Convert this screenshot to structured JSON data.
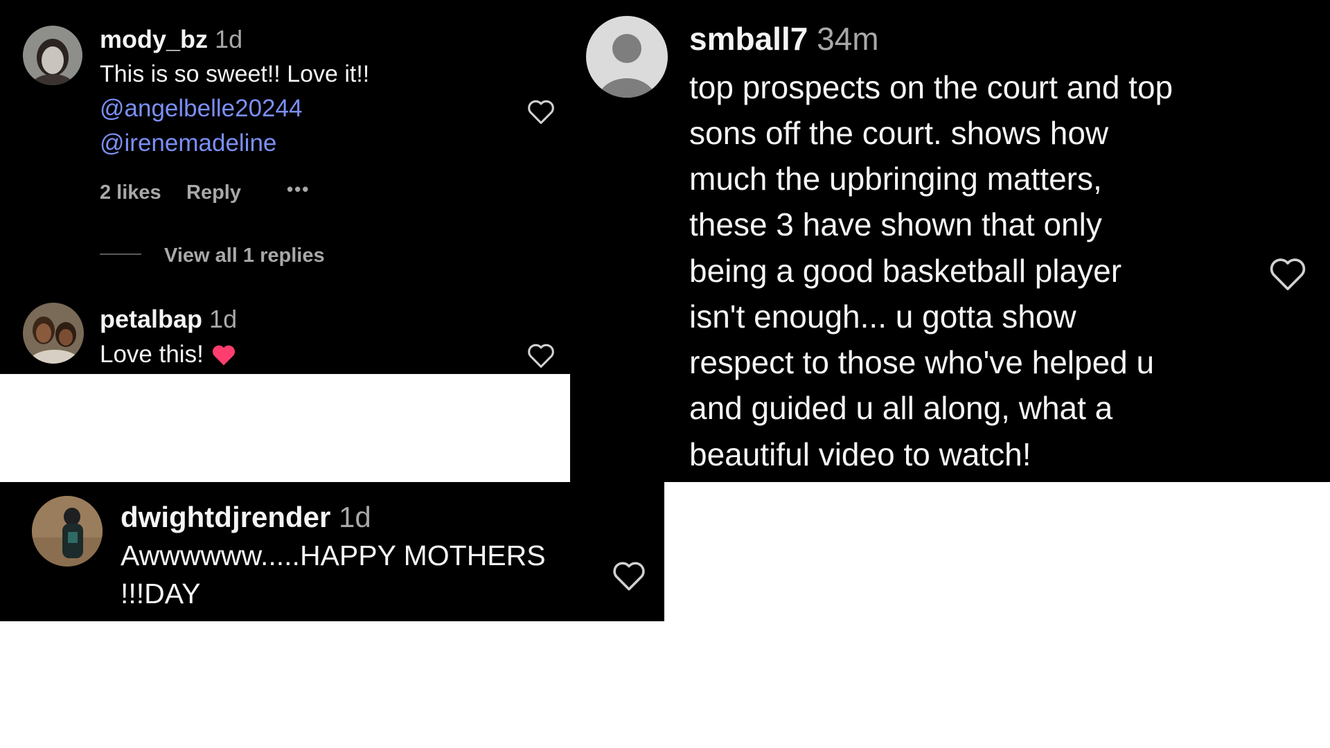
{
  "comments": [
    {
      "username": "mody_bz",
      "time": "1d",
      "text_line1": "This is so sweet!! Love it!!",
      "mention1": "@angelbelle20244",
      "mention2": "@irenemadeline",
      "likes": "2 likes",
      "reply_label": "Reply",
      "more_label": "•••",
      "view_replies": "View all 1 replies"
    },
    {
      "username": "petalbap",
      "time": "1d",
      "text": "Love this!",
      "emoji": "heart-emoji"
    },
    {
      "username": "smball7",
      "time": "34m",
      "lines": [
        "top prospects on the court and top",
        "sons off the court. shows how",
        "much the upbringing matters,",
        "these 3 have shown that only",
        "being a good basketball player",
        "isn't enough... u gotta show",
        "respect to those who've helped u",
        "and guided u all along, what a",
        "beautiful video to watch!"
      ]
    },
    {
      "username": "dwightdjrender",
      "time": "1d",
      "lines": [
        "Awwwwww.....HAPPY MOTHERS",
        "!!!DAY"
      ]
    }
  ],
  "colors": {
    "background": "#000000",
    "text": "#f5f5f5",
    "muted": "#a8a8a8",
    "mention": "#7b8ff6",
    "emoji_heart": "#ff3d6e"
  }
}
